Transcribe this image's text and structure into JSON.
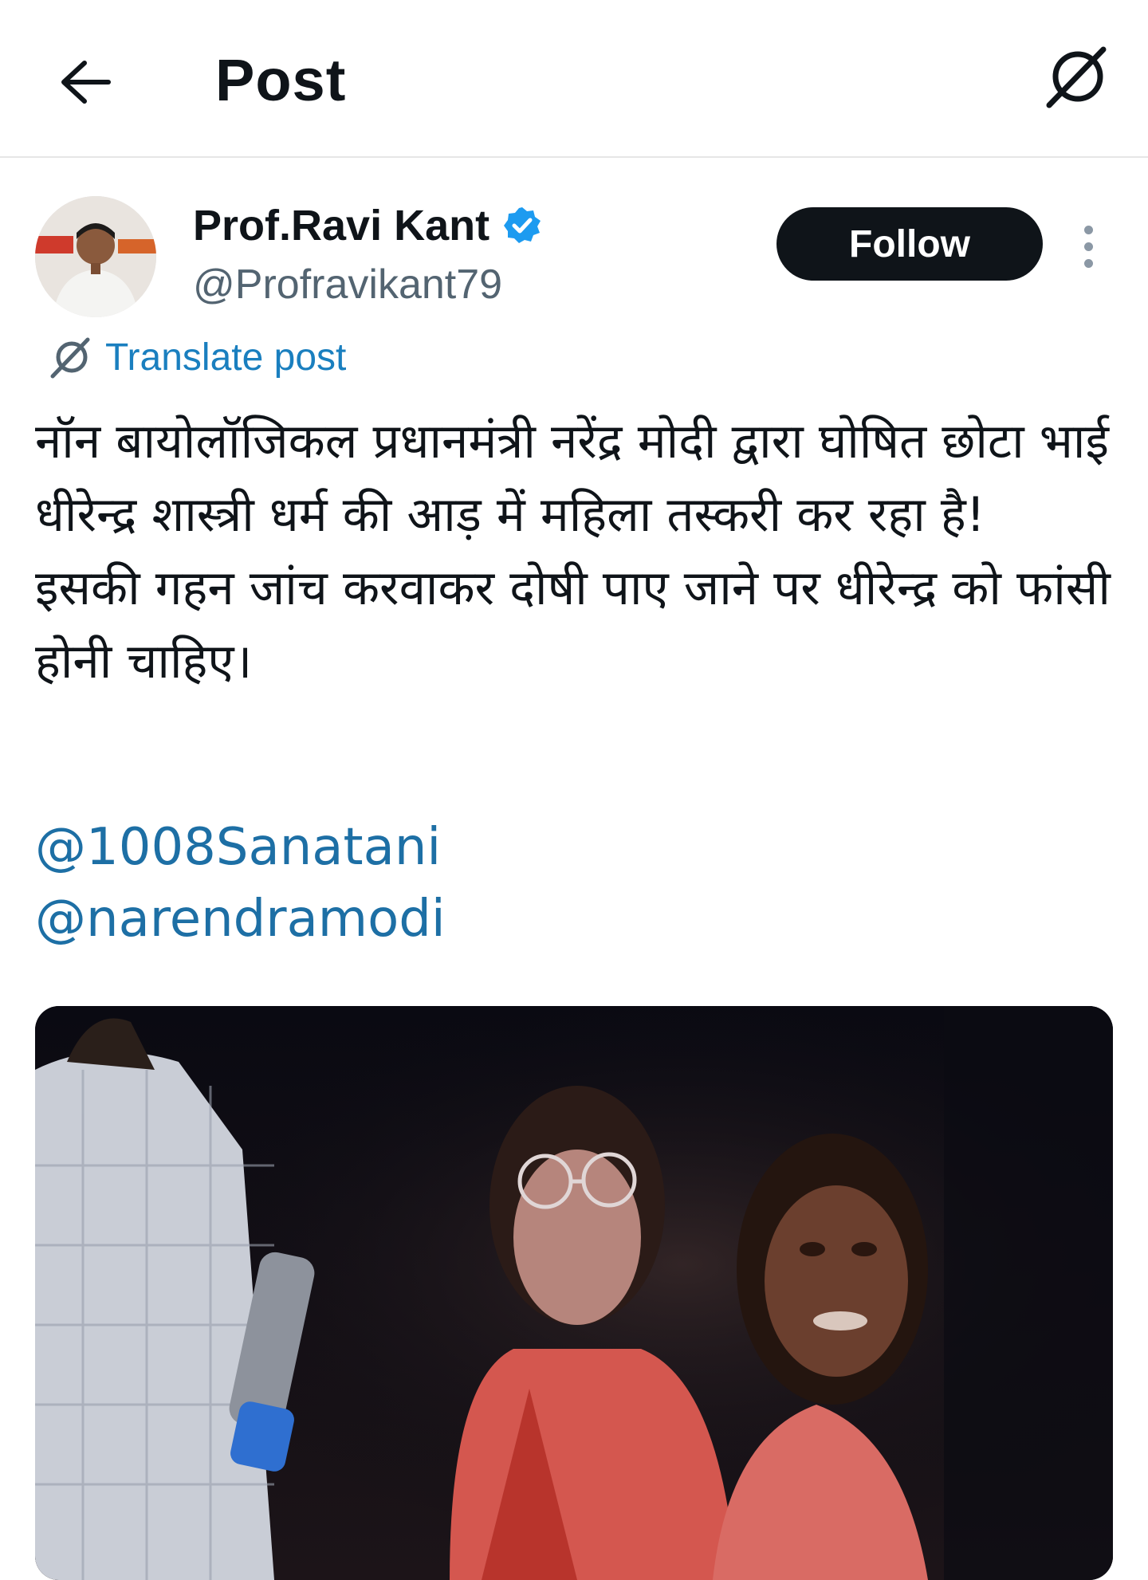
{
  "header": {
    "title": "Post",
    "back_icon": "arrow-left-icon",
    "grok_icon": "grok-slash-icon"
  },
  "author": {
    "display_name": "Prof.Ravi Kant",
    "handle": "@Profravikant79",
    "verified": true,
    "verified_color": "#1d9bf0"
  },
  "actions": {
    "follow_label": "Follow",
    "more_icon": "more-vertical-icon"
  },
  "translate": {
    "label": "Translate post",
    "icon": "grok-slash-icon"
  },
  "post": {
    "paragraph_1": "नॉन बायोलॉजिकल प्रधानमंत्री नरेंद्र मोदी द्वारा घोषित छोटा भाई धीरेन्द्र शास्त्री धर्म की आड़ में महिला तस्करी कर रहा है!",
    "paragraph_2": "इसकी गहन जांच करवाकर दोषी पाए जाने पर धीरेन्द्र को फांसी होनी चाहिए।",
    "mentions": [
      "@1008Sanatani",
      "@narendramodi"
    ]
  },
  "colors": {
    "link": "#1d6fa5",
    "follow_bg": "#0f1419",
    "text": "#0f1419",
    "secondary": "#536471"
  }
}
